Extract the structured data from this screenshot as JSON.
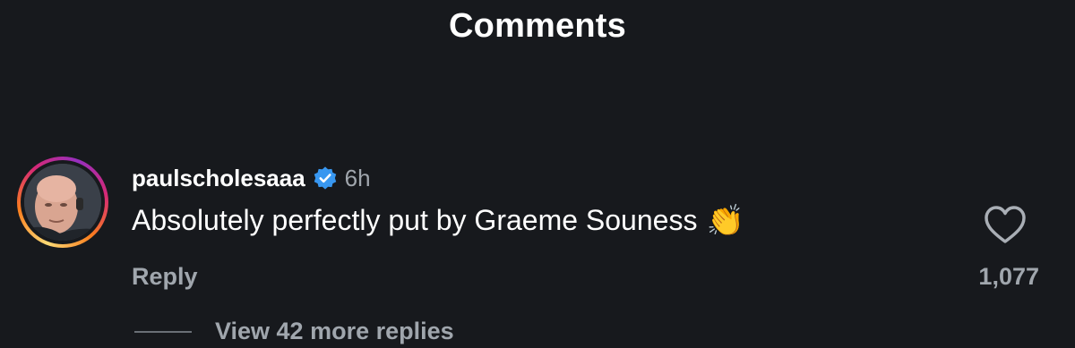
{
  "header": {
    "title": "Comments"
  },
  "comment": {
    "username": "paulscholesaaa",
    "verified": true,
    "time": "6h",
    "text": "Absolutely perfectly put by Graeme Souness",
    "emoji": "👏",
    "reply_label": "Reply",
    "like_count": "1,077",
    "view_replies_label": "View 42 more replies"
  },
  "colors": {
    "background": "#17191d",
    "verified_blue": "#3897f0",
    "muted_text": "#a0a6ad"
  },
  "icons": {
    "verified": "verified-badge-icon",
    "like": "heart-outline-icon"
  }
}
